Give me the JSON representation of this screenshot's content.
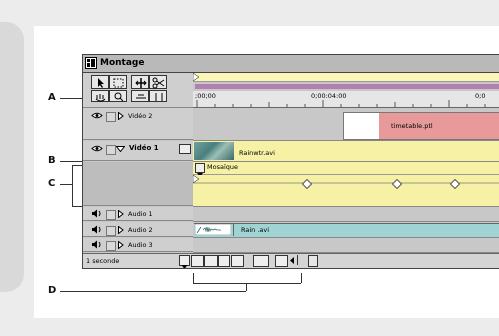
{
  "window": {
    "title": "Montage"
  },
  "ruler": {
    "start_time": ";00;00",
    "mid_time": "0;00:04:00",
    "end_time": "0;0"
  },
  "tracks": {
    "video2": {
      "label": "Vidéo 2",
      "clip_label": "timetable.ptl"
    },
    "video1": {
      "label": "Vidéo 1",
      "clip_label": "Rainwtr.avi",
      "transition_label": "Mosaïque"
    },
    "audio1": {
      "label": "Audio 1"
    },
    "audio2": {
      "label": "Audio 2",
      "clip_label": "Rain .avi"
    },
    "audio3": {
      "label": "Audio 3"
    }
  },
  "bottom_bar": {
    "time_unit": "1 seconde"
  },
  "callouts": {
    "a": "A",
    "b": "B",
    "c": "C",
    "d": "D"
  },
  "colors": {
    "clip_yellow": "#f7f1a6",
    "clip_pink": "#e89a9a",
    "clip_teal": "#9fd4d2",
    "work_area_purple": "#b17fb1"
  }
}
